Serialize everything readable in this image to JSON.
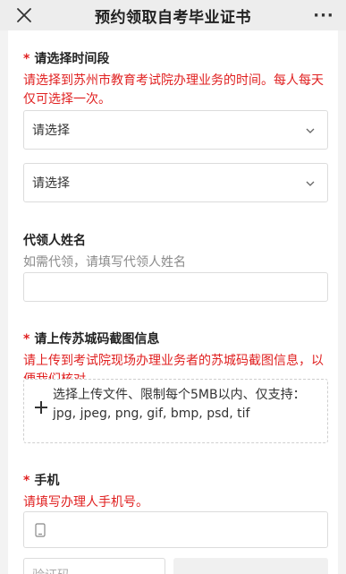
{
  "topbar": {
    "title": "预约领取自考毕业证书",
    "more_label": "···"
  },
  "section_time": {
    "required_mark": "*",
    "label": "请选择时间段",
    "hint": "请选择到苏州市教育考试院办理业务的时间。每人每天仅可选择一次。",
    "select_1": "请选择",
    "select_2": "请选择"
  },
  "section_proxy": {
    "label": "代领人姓名",
    "hint": "如需代领，请填写代领人姓名"
  },
  "section_upload": {
    "required_mark": "*",
    "label": "请上传苏城码截图信息",
    "hint": "请上传到考试院现场办理业务者的苏城码截图信息，以便我们核对。",
    "upload_text": "选择上传文件、限制每个5MB以内、仅支持：jpg, jpeg, png, gif, bmp, psd, tif"
  },
  "section_phone": {
    "required_mark": "*",
    "label": "手机",
    "hint": "请填写办理人手机号。",
    "code_placeholder": "验证码"
  }
}
